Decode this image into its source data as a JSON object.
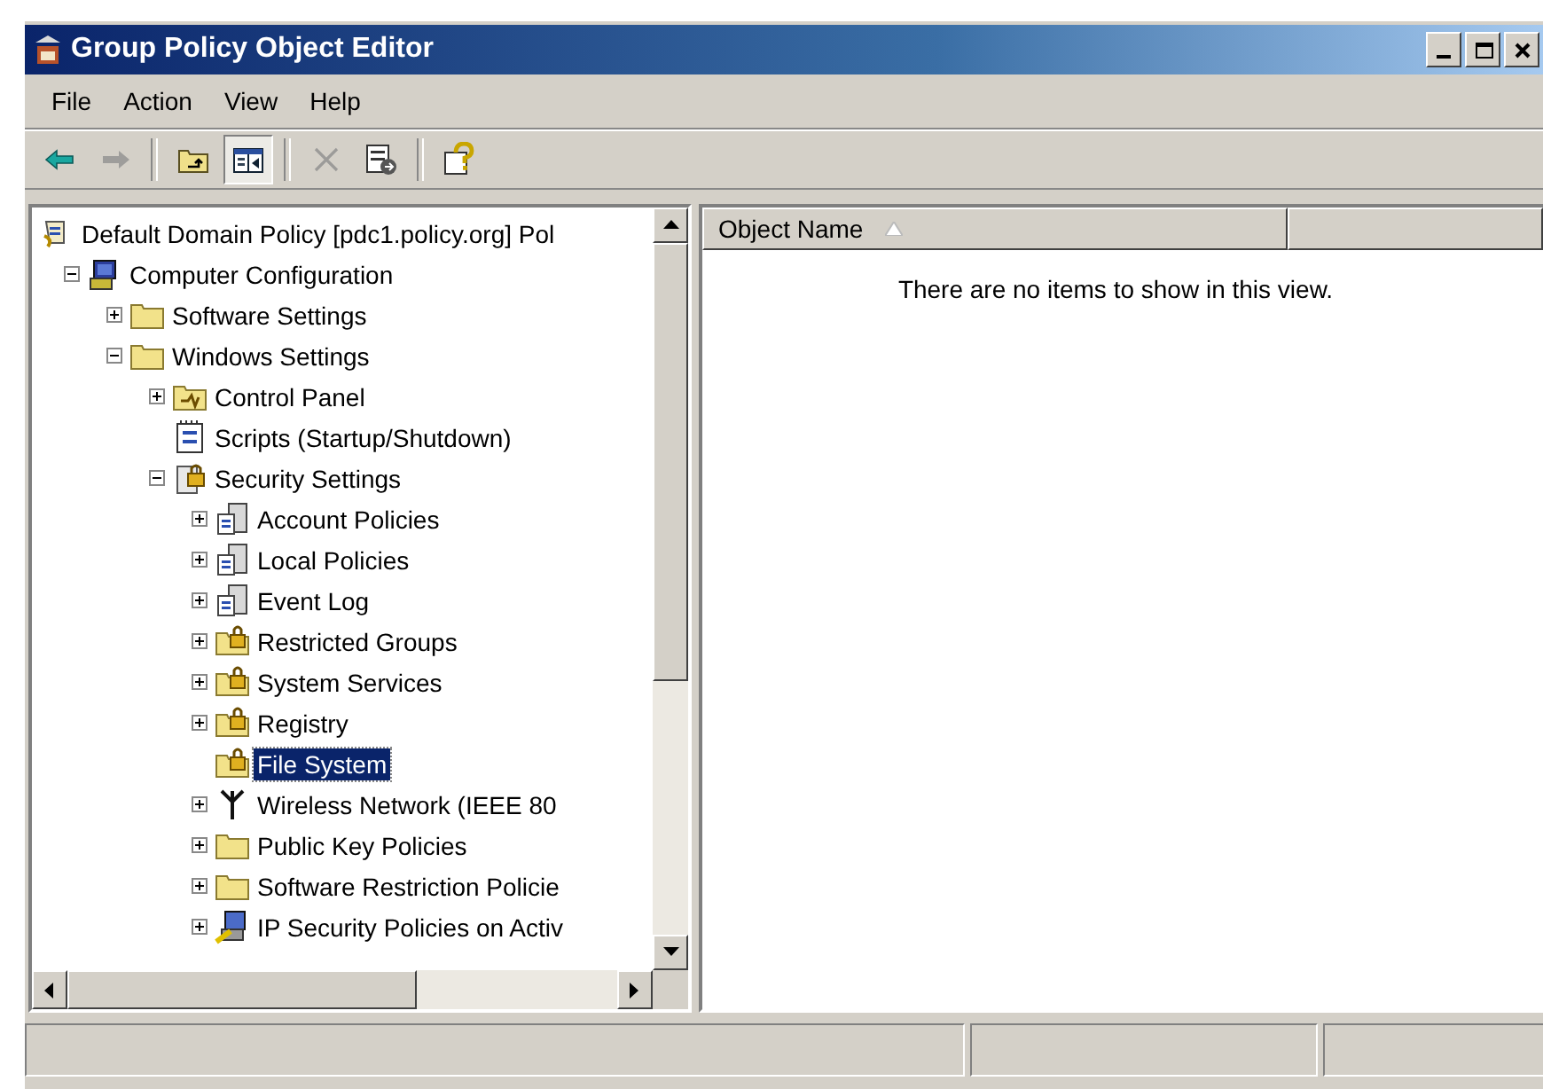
{
  "window": {
    "title": "Group Policy Object Editor"
  },
  "menu": [
    {
      "label": "File"
    },
    {
      "label": "Action"
    },
    {
      "label": "View"
    },
    {
      "label": "Help"
    }
  ],
  "toolbar": [
    {
      "kind": "back",
      "disabled": false,
      "selected": false
    },
    {
      "kind": "forward",
      "disabled": true,
      "selected": false
    },
    {
      "kind": "separator"
    },
    {
      "kind": "up",
      "disabled": false,
      "selected": false
    },
    {
      "kind": "tree",
      "disabled": false,
      "selected": true
    },
    {
      "kind": "separator"
    },
    {
      "kind": "delete",
      "disabled": true,
      "selected": false
    },
    {
      "kind": "export",
      "disabled": false,
      "selected": false
    },
    {
      "kind": "separator"
    },
    {
      "kind": "help",
      "disabled": false,
      "selected": false
    }
  ],
  "tree": [
    {
      "label": "Default Domain Policy [pdc1.policy.org] Pol",
      "kind": "policy",
      "selected": false,
      "children": [
        {
          "label": "Computer Configuration",
          "kind": "computer",
          "selected": false,
          "expanded": true,
          "children": [
            {
              "label": "Software Settings",
              "kind": "folder",
              "selected": false,
              "expanded": false
            },
            {
              "label": "Windows Settings",
              "kind": "folder",
              "selected": false,
              "expanded": true,
              "children": [
                {
                  "label": "Control Panel",
                  "kind": "control-panel",
                  "selected": false,
                  "expanded": false
                },
                {
                  "label": "Scripts (Startup/Shutdown)",
                  "kind": "script",
                  "selected": false
                },
                {
                  "label": "Security Settings",
                  "kind": "security",
                  "selected": false,
                  "expanded": true,
                  "children": [
                    {
                      "label": "Account Policies",
                      "kind": "server",
                      "selected": false,
                      "expanded": false
                    },
                    {
                      "label": "Local Policies",
                      "kind": "server",
                      "selected": false,
                      "expanded": false
                    },
                    {
                      "label": "Event Log",
                      "kind": "server",
                      "selected": false,
                      "expanded": false
                    },
                    {
                      "label": "Restricted Groups",
                      "kind": "lock-folder",
                      "selected": false,
                      "expanded": false
                    },
                    {
                      "label": "System Services",
                      "kind": "lock-folder",
                      "selected": false,
                      "expanded": false
                    },
                    {
                      "label": "Registry",
                      "kind": "lock-folder",
                      "selected": false,
                      "expanded": false
                    },
                    {
                      "label": "File System",
                      "kind": "lock-folder",
                      "selected": true
                    },
                    {
                      "label": "Wireless Network (IEEE 80",
                      "kind": "antenna",
                      "selected": false,
                      "expanded": false
                    },
                    {
                      "label": "Public Key Policies",
                      "kind": "folder",
                      "selected": false,
                      "expanded": false
                    },
                    {
                      "label": "Software Restriction Policie",
                      "kind": "folder",
                      "selected": false,
                      "expanded": false
                    },
                    {
                      "label": "IP Security Policies on Activ",
                      "kind": "ip-security",
                      "selected": false,
                      "expanded": false
                    }
                  ]
                }
              ]
            }
          ]
        }
      ]
    }
  ],
  "list": {
    "columns": [
      {
        "label": "Object Name",
        "sorted": true
      },
      {}
    ],
    "message": "There are no items to show in this view."
  }
}
